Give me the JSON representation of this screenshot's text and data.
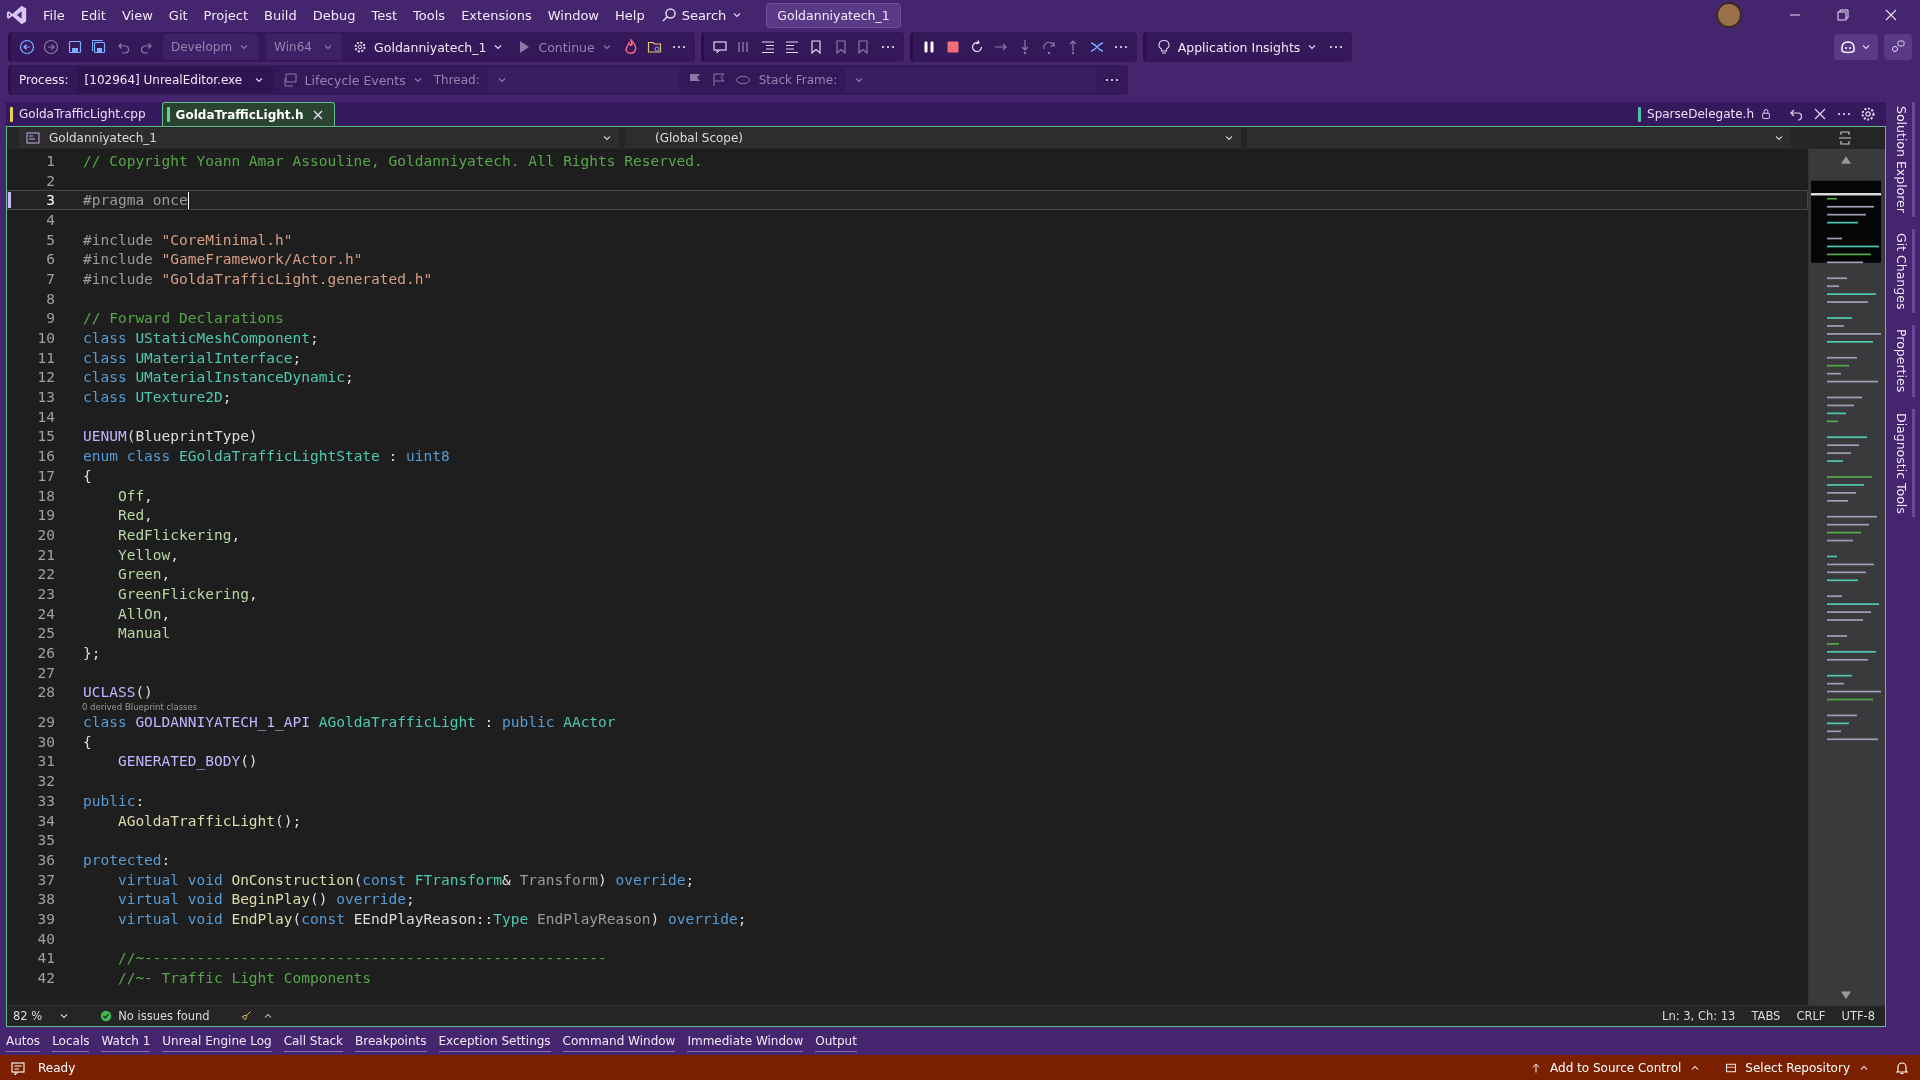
{
  "menu": [
    "File",
    "Edit",
    "View",
    "Git",
    "Project",
    "Build",
    "Debug",
    "Test",
    "Tools",
    "Extensions",
    "Window",
    "Help"
  ],
  "search": "Search",
  "solution_badge": "Goldanniyatech_1",
  "toolbar": {
    "configuration": "Developm",
    "platform": "Win64",
    "startup_project": "Goldanniyatech_1",
    "continue": "Continue",
    "insights": "Application Insights"
  },
  "debug_location": {
    "process_label": "Process:",
    "process": "[102964] UnrealEditor.exe",
    "lifecycle": "Lifecycle Events",
    "thread_label": "Thread:",
    "stack_label": "Stack Frame:"
  },
  "tabs": [
    {
      "label": "GoldaTrafficLight.cpp",
      "selected": false,
      "color": "#e8d44d"
    },
    {
      "label": "GoldaTrafficLight.h",
      "selected": true,
      "color": "#6ccf8f"
    }
  ],
  "preview_tab": {
    "label": "SparseDelegate.h",
    "color": "#4fc1a6"
  },
  "navigation": {
    "project": "Goldanniyatech_1",
    "scope": "(Global Scope)"
  },
  "code": [
    {
      "n": "1",
      "current": false,
      "tokens": [
        {
          "kind": "comment",
          "text": "// Copyright Yoann Amar Assouline, Goldanniyatech. All Rights Reserved."
        }
      ]
    },
    {
      "n": "2",
      "current": false
    },
    {
      "n": "3",
      "current": true,
      "tokens": [
        {
          "kind": "preproc",
          "text": "#pragma once"
        }
      ]
    },
    {
      "n": "4",
      "current": false
    },
    {
      "n": "5",
      "current": false,
      "tokens": [
        {
          "kind": "preproc",
          "text": "#include "
        },
        {
          "kind": "string",
          "text": "\"CoreMinimal.h\""
        }
      ]
    },
    {
      "n": "6",
      "current": false,
      "tokens": [
        {
          "kind": "preproc",
          "text": "#include "
        },
        {
          "kind": "string",
          "text": "\"GameFramework/Actor.h\""
        }
      ]
    },
    {
      "n": "7",
      "current": false,
      "tokens": [
        {
          "kind": "preproc",
          "text": "#include "
        },
        {
          "kind": "string",
          "text": "\"GoldaTrafficLight.generated.h\""
        }
      ]
    },
    {
      "n": "8",
      "current": false
    },
    {
      "n": "9",
      "current": false,
      "tokens": [
        {
          "kind": "comment",
          "text": "// Forward Declarations"
        }
      ]
    },
    {
      "n": "10",
      "current": false,
      "tokens": [
        {
          "kind": "keyword",
          "text": "class "
        },
        {
          "kind": "type",
          "text": "UStaticMeshComponent"
        },
        {
          "kind": "plain",
          "text": ";"
        }
      ]
    },
    {
      "n": "11",
      "current": false,
      "tokens": [
        {
          "kind": "keyword",
          "text": "class "
        },
        {
          "kind": "type",
          "text": "UMaterialInterface"
        },
        {
          "kind": "plain",
          "text": ";"
        }
      ]
    },
    {
      "n": "12",
      "current": false,
      "tokens": [
        {
          "kind": "keyword",
          "text": "class "
        },
        {
          "kind": "type",
          "text": "UMaterialInstanceDynamic"
        },
        {
          "kind": "plain",
          "text": ";"
        }
      ]
    },
    {
      "n": "13",
      "current": false,
      "tokens": [
        {
          "kind": "keyword",
          "text": "class "
        },
        {
          "kind": "type",
          "text": "UTexture2D"
        },
        {
          "kind": "plain",
          "text": ";"
        }
      ]
    },
    {
      "n": "14",
      "current": false
    },
    {
      "n": "15",
      "current": false,
      "tokens": [
        {
          "kind": "macro",
          "text": "UENUM"
        },
        {
          "kind": "plain",
          "text": "(BlueprintType)"
        }
      ]
    },
    {
      "n": "16",
      "current": false,
      "tokens": [
        {
          "kind": "keyword",
          "text": "enum class "
        },
        {
          "kind": "type",
          "text": "EGoldaTrafficLightState"
        },
        {
          "kind": "plain",
          "text": " : "
        },
        {
          "kind": "keyword",
          "text": "uint8"
        }
      ]
    },
    {
      "n": "17",
      "current": false,
      "tokens": [
        {
          "kind": "plain",
          "text": "{"
        }
      ]
    },
    {
      "n": "18",
      "current": false,
      "tokens": [
        {
          "kind": "enumerator",
          "text": "    Off"
        },
        {
          "kind": "plain",
          "text": ","
        }
      ]
    },
    {
      "n": "19",
      "current": false,
      "tokens": [
        {
          "kind": "enumerator",
          "text": "    Red"
        },
        {
          "kind": "plain",
          "text": ","
        }
      ]
    },
    {
      "n": "20",
      "current": false,
      "tokens": [
        {
          "kind": "enumerator",
          "text": "    RedFlickering"
        },
        {
          "kind": "plain",
          "text": ","
        }
      ]
    },
    {
      "n": "21",
      "current": false,
      "tokens": [
        {
          "kind": "enumerator",
          "text": "    Yellow"
        },
        {
          "kind": "plain",
          "text": ","
        }
      ]
    },
    {
      "n": "22",
      "current": false,
      "tokens": [
        {
          "kind": "enumerator",
          "text": "    Green"
        },
        {
          "kind": "plain",
          "text": ","
        }
      ]
    },
    {
      "n": "23",
      "current": false,
      "tokens": [
        {
          "kind": "enumerator",
          "text": "    GreenFlickering"
        },
        {
          "kind": "plain",
          "text": ","
        }
      ]
    },
    {
      "n": "24",
      "current": false,
      "tokens": [
        {
          "kind": "enumerator",
          "text": "    AllOn"
        },
        {
          "kind": "plain",
          "text": ","
        }
      ]
    },
    {
      "n": "25",
      "current": false,
      "tokens": [
        {
          "kind": "enumerator",
          "text": "    Manual"
        }
      ]
    },
    {
      "n": "26",
      "current": false,
      "tokens": [
        {
          "kind": "plain",
          "text": "};"
        }
      ]
    },
    {
      "n": "27",
      "current": false
    },
    {
      "n": "28",
      "current": false,
      "tokens": [
        {
          "kind": "macro",
          "text": "UCLASS"
        },
        {
          "kind": "plain",
          "text": "()"
        }
      ]
    },
    {
      "n": "29",
      "current": false,
      "hint": "0 derived Blueprint classes",
      "tokens": [
        {
          "kind": "keyword",
          "text": "class "
        },
        {
          "kind": "macro",
          "text": "GOLDANNIYATECH_1_API "
        },
        {
          "kind": "type",
          "text": "AGoldaTrafficLight"
        },
        {
          "kind": "plain",
          "text": " : "
        },
        {
          "kind": "keyword",
          "text": "public "
        },
        {
          "kind": "type",
          "text": "AActor"
        }
      ]
    },
    {
      "n": "30",
      "current": false,
      "tokens": [
        {
          "kind": "plain",
          "text": "{"
        }
      ]
    },
    {
      "n": "31",
      "current": false,
      "tokens": [
        {
          "kind": "macro",
          "text": "    GENERATED_BODY"
        },
        {
          "kind": "plain",
          "text": "()"
        }
      ]
    },
    {
      "n": "32",
      "current": false
    },
    {
      "n": "33",
      "current": false,
      "tokens": [
        {
          "kind": "keyword",
          "text": "public"
        },
        {
          "kind": "plain",
          "text": ":"
        }
      ]
    },
    {
      "n": "34",
      "current": false,
      "tokens": [
        {
          "kind": "function",
          "text": "    AGoldaTrafficLight"
        },
        {
          "kind": "plain",
          "text": "();"
        }
      ]
    },
    {
      "n": "35",
      "current": false
    },
    {
      "n": "36",
      "current": false,
      "tokens": [
        {
          "kind": "keyword",
          "text": "protected"
        },
        {
          "kind": "plain",
          "text": ":"
        }
      ]
    },
    {
      "n": "37",
      "current": false,
      "tokens": [
        {
          "kind": "keyword",
          "text": "    virtual void "
        },
        {
          "kind": "function",
          "text": "OnConstruction"
        },
        {
          "kind": "plain",
          "text": "("
        },
        {
          "kind": "keyword",
          "text": "const "
        },
        {
          "kind": "type",
          "text": "FTransform"
        },
        {
          "kind": "plain",
          "text": "& "
        },
        {
          "kind": "parameter",
          "text": "Transform"
        },
        {
          "kind": "plain",
          "text": ") "
        },
        {
          "kind": "keyword",
          "text": "override"
        },
        {
          "kind": "plain",
          "text": ";"
        }
      ]
    },
    {
      "n": "38",
      "current": false,
      "tokens": [
        {
          "kind": "keyword",
          "text": "    virtual void "
        },
        {
          "kind": "function",
          "text": "BeginPlay"
        },
        {
          "kind": "plain",
          "text": "() "
        },
        {
          "kind": "keyword",
          "text": "override"
        },
        {
          "kind": "plain",
          "text": ";"
        }
      ]
    },
    {
      "n": "39",
      "current": false,
      "tokens": [
        {
          "kind": "keyword",
          "text": "    virtual void "
        },
        {
          "kind": "function",
          "text": "EndPlay"
        },
        {
          "kind": "plain",
          "text": "("
        },
        {
          "kind": "keyword",
          "text": "const "
        },
        {
          "kind": "plain",
          "text": "EEndPlayReason::"
        },
        {
          "kind": "type",
          "text": "Type "
        },
        {
          "kind": "parameter",
          "text": "EndPlayReason"
        },
        {
          "kind": "plain",
          "text": ") "
        },
        {
          "kind": "keyword",
          "text": "override"
        },
        {
          "kind": "plain",
          "text": ";"
        }
      ]
    },
    {
      "n": "40",
      "current": false
    },
    {
      "n": "41",
      "current": false,
      "tokens": [
        {
          "kind": "comment",
          "text": "    //~-----------------------------------------------------"
        }
      ]
    },
    {
      "n": "42",
      "current": false,
      "tokens": [
        {
          "kind": "comment",
          "text": "    //~- Traffic Light Components"
        }
      ]
    }
  ],
  "editor_status": {
    "zoom": "82 %",
    "issues": "No issues found",
    "position": "Ln: 3, Ch: 13",
    "indent": "TABS",
    "line_endings": "CRLF",
    "encoding": "UTF-8"
  },
  "tool_windows": [
    "Autos",
    "Locals",
    "Watch 1",
    "Unreal Engine Log",
    "Call Stack",
    "Breakpoints",
    "Exception Settings",
    "Command Window",
    "Immediate Window",
    "Output"
  ],
  "side_tabs": [
    "Solution Explorer",
    "Git Changes",
    "Properties",
    "Diagnostic Tools"
  ],
  "status_bar": {
    "state": "Ready",
    "source_control": "Add to Source Control",
    "repository": "Select Repository"
  }
}
